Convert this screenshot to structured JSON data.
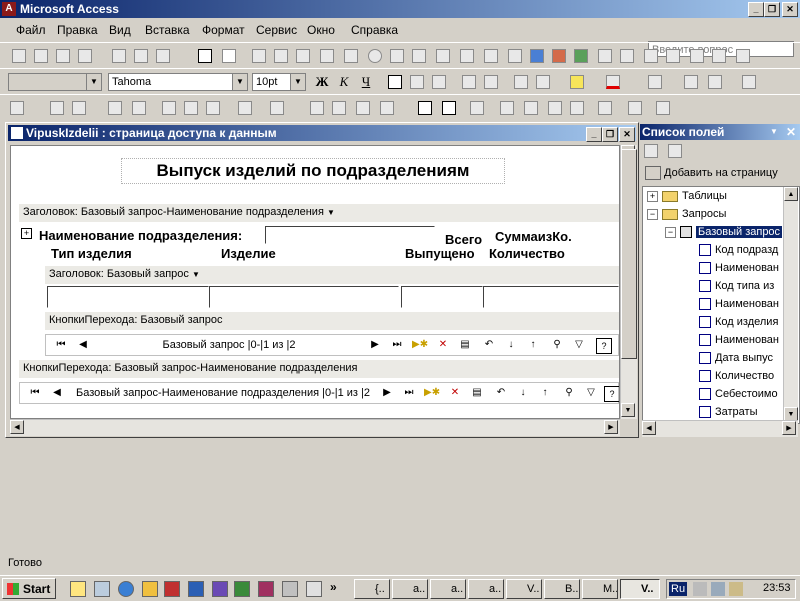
{
  "app": {
    "title": "Microsoft Access",
    "window_controls": [
      "_",
      "❐",
      "✕"
    ]
  },
  "menu": {
    "items": [
      "Файл",
      "Правка",
      "Вид",
      "Вставка",
      "Формат",
      "Сервис",
      "Окно",
      "Справка"
    ],
    "ask_placeholder": "Введите вопрос"
  },
  "format_toolbar": {
    "font_name": "Tahoma",
    "font_size": "10pt",
    "bold": "Ж",
    "italic": "К",
    "underline": "Ч"
  },
  "dap_window": {
    "title": "VipuskIzdelii : страница доступа к данным",
    "heading": "Выпуск изделий по подразделениям",
    "header_band": "Заголовок: Базовый запрос-Наименование подразделения",
    "group_label": "Наименование подразделения:",
    "col_total": "Всего",
    "col_sum": "СуммаизКо.",
    "col_product_type": "Тип изделия",
    "col_product": "Изделие",
    "col_released": "Выпущено",
    "col_quantity": "Количество",
    "inner_header_band": "Заголовок: Базовый запрос",
    "inner_nav_band": "КнопкиПерехода: Базовый запрос",
    "inner_nav_text": "Базовый запрос |0-|1 из |2",
    "outer_nav_band": "КнопкиПерехода: Базовый запрос-Наименование подразделения",
    "outer_nav_text": "Базовый запрос-Наименование подразделения |0-|1 из |2"
  },
  "field_list": {
    "title": "Список полей",
    "add_to_page": "Добавить на страницу",
    "tree": [
      {
        "label": "Таблицы",
        "level": 0,
        "expander": "+",
        "kind": "folder"
      },
      {
        "label": "Запросы",
        "level": 0,
        "expander": "−",
        "kind": "folder"
      },
      {
        "label": "Базовый запрос",
        "level": 1,
        "expander": "−",
        "kind": "query",
        "selected": true
      },
      {
        "label": "Код подразд",
        "level": 2,
        "kind": "field"
      },
      {
        "label": "Наименован",
        "level": 2,
        "kind": "field"
      },
      {
        "label": "Код типа из",
        "level": 2,
        "kind": "field"
      },
      {
        "label": "Наименован",
        "level": 2,
        "kind": "field"
      },
      {
        "label": "Код изделия",
        "level": 2,
        "kind": "field"
      },
      {
        "label": "Наименован",
        "level": 2,
        "kind": "field"
      },
      {
        "label": "Дата выпус",
        "level": 2,
        "kind": "field"
      },
      {
        "label": "Количество",
        "level": 2,
        "kind": "field"
      },
      {
        "label": "Себестоимо",
        "level": 2,
        "kind": "field"
      },
      {
        "label": "Затраты",
        "level": 2,
        "kind": "field"
      }
    ]
  },
  "status": {
    "text": "Готово"
  },
  "taskbar": {
    "start": "Start",
    "tasks": [
      "{..",
      "a..",
      "a..",
      "a..",
      "V..",
      "B..",
      "M..",
      "V.."
    ],
    "lang": "Ru",
    "clock": "23:53"
  },
  "colors": {
    "title_start": "#0a246a",
    "title_end": "#a6caf0",
    "face": "#d4d0c8"
  }
}
